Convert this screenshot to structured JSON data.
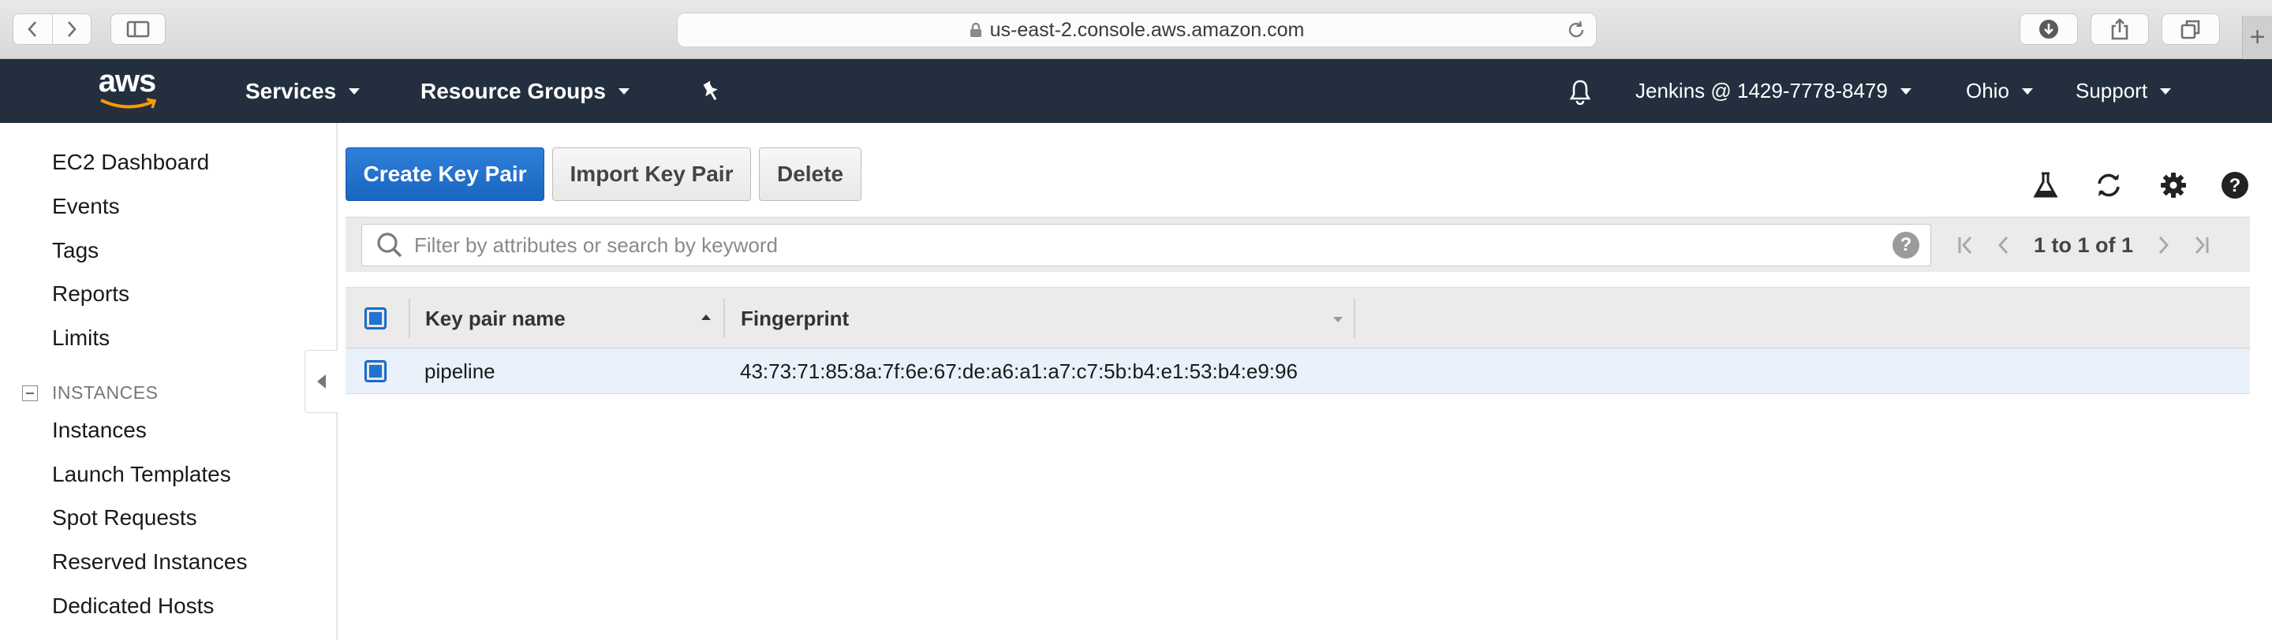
{
  "browser": {
    "url": "us-east-2.console.aws.amazon.com"
  },
  "nav": {
    "logo_text": "aws",
    "services": "Services",
    "resource_groups": "Resource Groups",
    "account": "Jenkins @ 1429-7778-8479",
    "region": "Ohio",
    "support": "Support"
  },
  "sidebar": {
    "items": [
      "EC2 Dashboard",
      "Events",
      "Tags",
      "Reports",
      "Limits"
    ],
    "section_instances": "INSTANCES",
    "instance_items": [
      "Instances",
      "Launch Templates",
      "Spot Requests",
      "Reserved Instances",
      "Dedicated Hosts"
    ]
  },
  "toolbar": {
    "create_label": "Create Key Pair",
    "import_label": "Import Key Pair",
    "delete_label": "Delete"
  },
  "filter": {
    "placeholder": "Filter by attributes or search by keyword",
    "help": "?",
    "pagination": "1 to 1 of 1"
  },
  "table": {
    "columns": [
      "Key pair name",
      "Fingerprint"
    ],
    "rows": [
      {
        "name": "pipeline",
        "fingerprint": "43:73:71:85:8a:7f:6e:67:de:a6:a1:a7:c7:5b:b4:e1:53:b4:e9:96",
        "selected": true
      }
    ]
  },
  "colors": {
    "nav_bg": "#232f3e",
    "primary": "#1f73d2",
    "row_selected": "#e9f1fb",
    "logo_smile": "#ff9900"
  }
}
